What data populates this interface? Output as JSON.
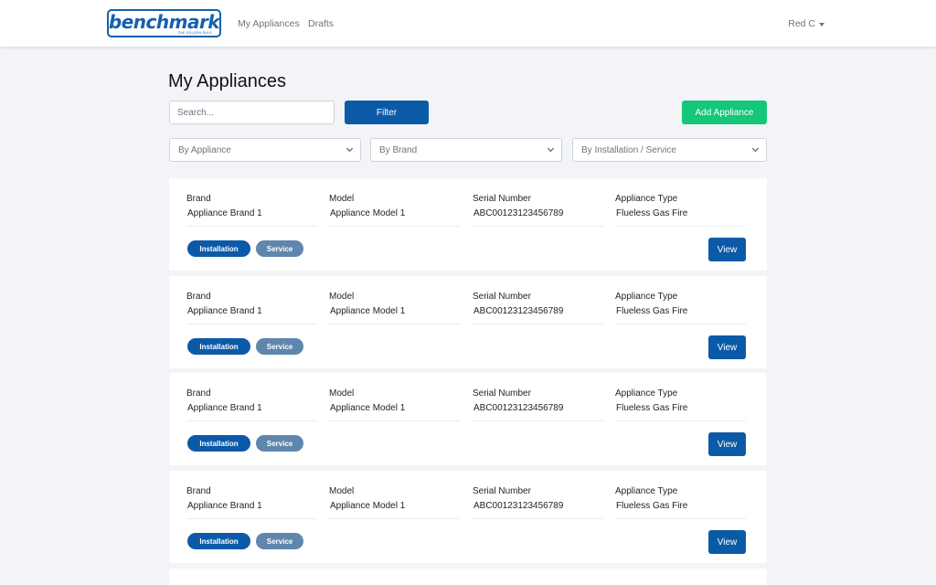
{
  "brand": {
    "logo_text": "benchmark",
    "logo_sub": "THE GOLDEN RULE",
    "accent": "#1660ad"
  },
  "nav": {
    "items": [
      "My Appliances",
      "Drafts"
    ],
    "user": "Red C"
  },
  "page": {
    "title": "My Appliances",
    "search_placeholder": "Search...",
    "filter_label": "Filter",
    "add_label": "Add Appliance",
    "filters": [
      "By Appliance",
      "By Brand",
      "By Installation / Service"
    ]
  },
  "labels": {
    "brand": "Brand",
    "model": "Model",
    "serial": "Serial Number",
    "type": "Appliance Type"
  },
  "appliances": [
    {
      "brand": "Appliance Brand 1",
      "model": "Appliance Model 1",
      "serial": "ABC00123123456789",
      "type": "Flueless Gas Fire",
      "tags": [
        "Installation",
        "Service"
      ],
      "action": "View"
    },
    {
      "brand": "Appliance Brand 1",
      "model": "Appliance Model 1",
      "serial": "ABC00123123456789",
      "type": "Flueless Gas Fire",
      "tags": [
        "Installation",
        "Service"
      ],
      "action": "View"
    },
    {
      "brand": "Appliance Brand 1",
      "model": "Appliance Model 1",
      "serial": "ABC00123123456789",
      "type": "Flueless Gas Fire",
      "tags": [
        "Installation",
        "Service"
      ],
      "action": "View"
    },
    {
      "brand": "Appliance Brand 1",
      "model": "Appliance Model 1",
      "serial": "ABC00123123456789",
      "type": "Flueless Gas Fire",
      "tags": [
        "Installation",
        "Service"
      ],
      "action": "View"
    }
  ]
}
